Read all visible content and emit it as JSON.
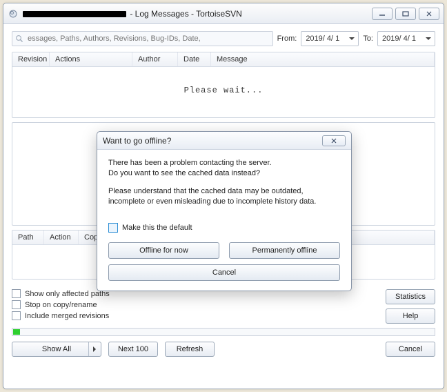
{
  "window": {
    "title_suffix": " - Log Messages - TortoiseSVN"
  },
  "filter": {
    "placeholder": "essages, Paths, Authors, Revisions, Bug-IDs, Date,",
    "from_label": "From:",
    "from_value": "2019/ 4/ 1",
    "to_label": "To:",
    "to_value": "2019/ 4/ 1"
  },
  "log_columns": {
    "revision": "Revision",
    "actions": "Actions",
    "author": "Author",
    "date": "Date",
    "message": "Message"
  },
  "loading_text": "Please wait...",
  "path_columns": {
    "path": "Path",
    "action": "Action",
    "copy": "Cop"
  },
  "checks": {
    "affected": "Show only affected paths",
    "stop_copy": "Stop on copy/rename",
    "merged": "Include merged revisions"
  },
  "buttons": {
    "statistics": "Statistics",
    "help": "Help",
    "cancel_main": "Cancel",
    "show_all": "Show All",
    "next_100": "Next 100",
    "refresh": "Refresh"
  },
  "dialog": {
    "title": "Want to go offline?",
    "line1a": "There has been a problem contacting the server.",
    "line1b": "Do you want to see the cached data instead?",
    "line2a": "Please understand that the cached data may be outdated,",
    "line2b": "incomplete or even misleading due to incomplete history data.",
    "make_default": "Make this the default",
    "offline_now": "Offline for now",
    "perm_offline": "Permanently offline",
    "cancel": "Cancel"
  }
}
